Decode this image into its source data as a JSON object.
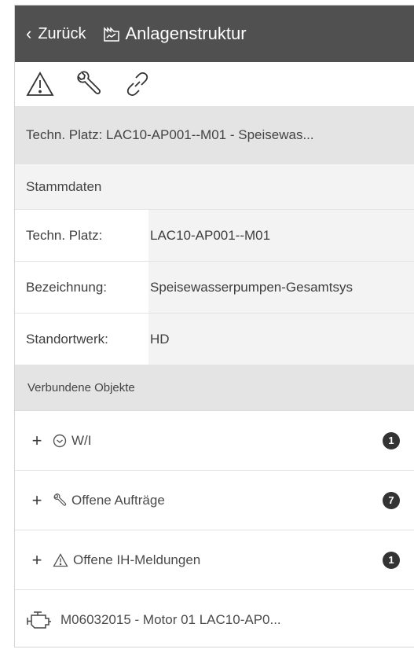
{
  "header": {
    "back_label": "Zurück",
    "title": "Anlagenstruktur",
    "title_icon": "factory-chart-icon"
  },
  "toolbar": {
    "icons": [
      "warning-icon",
      "wrench-icon",
      "link-icon"
    ]
  },
  "breadcrumb": {
    "text": "Techn. Platz: LAC10-AP001--M01 - Speisewas..."
  },
  "stammdaten": {
    "heading": "Stammdaten",
    "rows": [
      {
        "label": "Techn. Platz:",
        "value": "LAC10-AP001--M01"
      },
      {
        "label": "Bezeichnung:",
        "value": "Speisewasserpumpen-Gesamtsys"
      },
      {
        "label": "Standortwerk:",
        "value": "HD"
      }
    ]
  },
  "verbunden": {
    "heading": "Verbundene Objekte",
    "items": [
      {
        "label": "W/I",
        "icon": "clock-icon",
        "count": "1"
      },
      {
        "label": "Offene Aufträge",
        "icon": "wrench-icon",
        "count": "7"
      },
      {
        "label": "Offene IH-Meldungen",
        "icon": "warning-icon",
        "count": "1"
      }
    ]
  },
  "motor": {
    "label": "M06032015 - Motor 01 LAC10-AP0...",
    "icon": "engine-icon"
  },
  "colors": {
    "topbar": "#505050",
    "badge": "#333333",
    "section_bg": "#e4e4e4"
  }
}
